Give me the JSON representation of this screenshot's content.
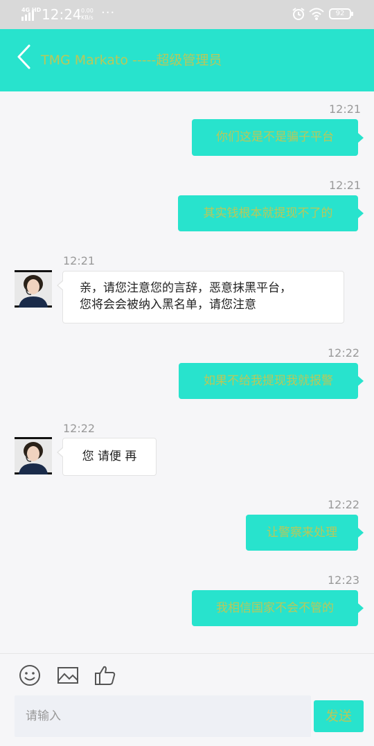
{
  "status_bar": {
    "network": "4G HD",
    "time": "12:24",
    "speed_value": "0.00",
    "speed_unit": "KB/s",
    "more": "···",
    "battery": "92"
  },
  "header": {
    "title": "TMG Markato -----超级管理员"
  },
  "messages": [
    {
      "direction": "out",
      "time": "12:21",
      "text": "你们这是不是骗子平台"
    },
    {
      "direction": "out",
      "time": "12:21",
      "text": "其实钱根本就提现不了的"
    },
    {
      "direction": "in",
      "time": "12:21",
      "line1": "亲，请您注意您的言辞，恶意抹黑平台，",
      "line2": "您将会会被纳入黑名单，请您注意"
    },
    {
      "direction": "out",
      "time": "12:22",
      "text": "如果不给我提现我就报警"
    },
    {
      "direction": "in",
      "time": "12:22",
      "text": "您 请便 再"
    },
    {
      "direction": "out",
      "time": "12:22",
      "text": "让警察来处理"
    },
    {
      "direction": "out",
      "time": "12:23",
      "text": "我相信国家不会不管的"
    }
  ],
  "input_bar": {
    "icons": [
      "emoji-icon",
      "image-icon",
      "thumbs-up-icon"
    ],
    "placeholder": "请输入",
    "send_label": "发送"
  },
  "colors": {
    "accent": "#28e3cd",
    "accent_text": "#b9c85a",
    "status_bar": "#d9d9d9"
  }
}
